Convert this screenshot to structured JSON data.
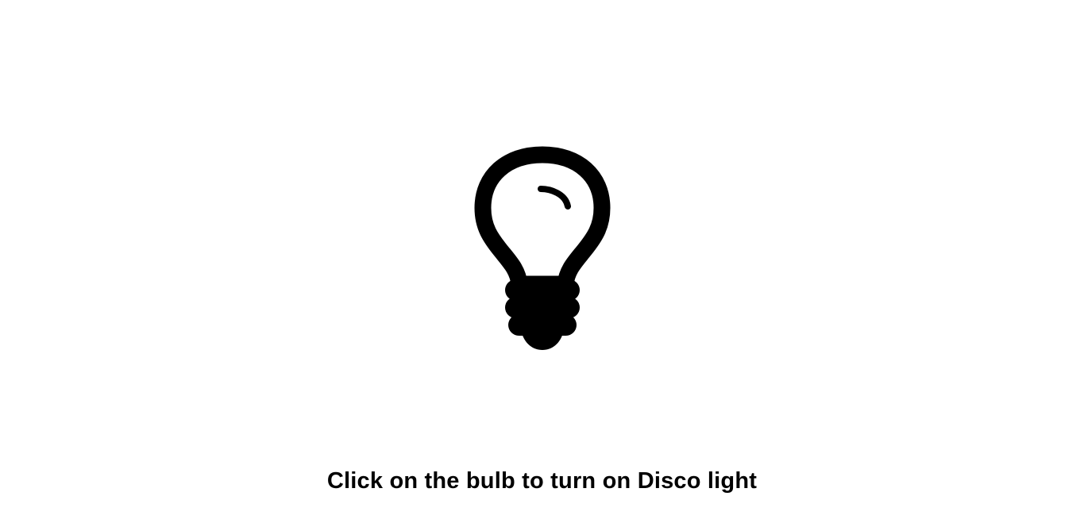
{
  "bulb": {
    "icon": "lightbulb-icon",
    "state": "off",
    "color": "#000000"
  },
  "instruction": {
    "text": "Click on the bulb to turn on Disco light"
  },
  "colors": {
    "background": "#ffffff",
    "foreground": "#000000"
  }
}
